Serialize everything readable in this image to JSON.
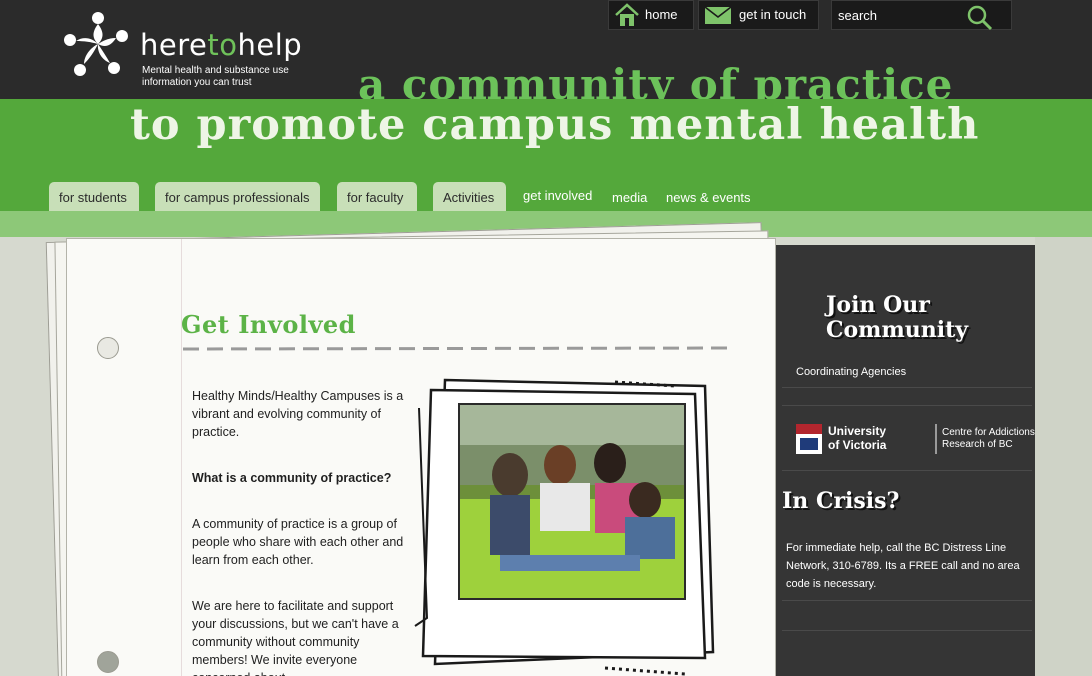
{
  "header": {
    "logo": {
      "prefix": "here",
      "accent": "to",
      "suffix": "help",
      "tagline": "Mental health and substance use information you can trust"
    },
    "tagline_top": "a community of practice",
    "tagline_bottom": "to promote campus mental health",
    "top_nav": {
      "home_label": "home",
      "home_icon": "home-icon",
      "contact_label": "get in touch",
      "contact_icon": "envelope-icon",
      "search_placeholder": "search",
      "search_icon": "magnifier-icon"
    }
  },
  "main_nav": {
    "tabs": [
      {
        "label": "for students"
      },
      {
        "label": "for campus professionals"
      },
      {
        "label": "for faculty"
      },
      {
        "label": "Activities"
      }
    ],
    "links": [
      {
        "label": "get involved"
      },
      {
        "label": "media"
      },
      {
        "label": "news & events"
      }
    ]
  },
  "content": {
    "title": "Get Involved",
    "paragraphs": [
      "Healthy Minds/Healthy Campuses is a vibrant and evolving community of practice.",
      "What is a community of practice?",
      "A community of practice is a group of people who share with each other and learn from each other.",
      "We are here to facilitate and support your discussions, but we can't have a community without community members! We invite everyone concerned about"
    ],
    "photo_icon": "students-photo"
  },
  "sidebar": {
    "join_line1": "Join Our",
    "join_line2": "Community",
    "coordinating": "Coordinating Agencies",
    "uvic_line1": "University",
    "uvic_line2": "of Victoria",
    "carbc_line1": "Centre for Addictions",
    "carbc_line2": "Research of BC",
    "crisis_title": "In Crisis?",
    "crisis_text": "For immediate help, call the BC Distress Line Network, 310-6789. Its a FREE call and no area code is necessary."
  },
  "colors": {
    "header_bg": "#2b2b2b",
    "brand_green": "#54a83b",
    "accent_green": "#6cc25a",
    "tab_bg": "#c8dfb8",
    "sidebar_bg": "#353535"
  }
}
